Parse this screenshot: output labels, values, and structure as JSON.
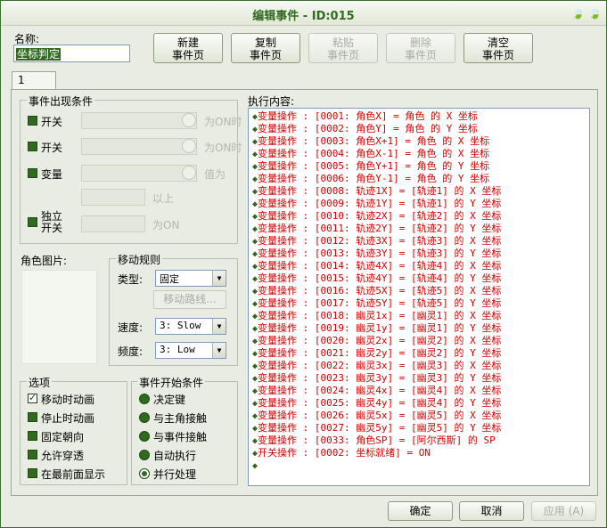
{
  "window": {
    "title": "编辑事件 - ID:015"
  },
  "name": {
    "label": "名称:",
    "value": "坐标判定"
  },
  "toolbar": {
    "new_page": [
      "新建",
      "事件页"
    ],
    "copy_page": [
      "复制",
      "事件页"
    ],
    "paste_page": [
      "粘贴",
      "事件页"
    ],
    "delete_page": [
      "删除",
      "事件页"
    ],
    "clear_page": [
      "清空",
      "事件页"
    ]
  },
  "tabs": [
    "1"
  ],
  "conditions": {
    "title": "事件出现条件",
    "switch1": {
      "label": "开关",
      "suffix": "为ON时"
    },
    "switch2": {
      "label": "开关",
      "suffix": "为ON时"
    },
    "variable": {
      "label": "变量",
      "suffix": "值为",
      "above": "以上"
    },
    "self_switch": {
      "label1": "独立",
      "label2": "开关",
      "suffix": "为ON"
    }
  },
  "graphic": {
    "label": "角色图片:"
  },
  "movement": {
    "title": "移动规则",
    "type_label": "类型:",
    "type_value": "固定",
    "route_button": "移动路线...",
    "speed_label": "速度:",
    "speed_value": "3: Slow",
    "freq_label": "频度:",
    "freq_value": "3: Low"
  },
  "options": {
    "title": "选项",
    "items": [
      "移动时动画",
      "停止时动画",
      "固定朝向",
      "允许穿透",
      "在最前面显示"
    ],
    "checked": [
      true,
      false,
      false,
      false,
      false
    ]
  },
  "trigger": {
    "title": "事件开始条件",
    "items": [
      "决定键",
      "与主角接触",
      "与事件接触",
      "自动执行",
      "并行处理"
    ],
    "selected": 4
  },
  "exec": {
    "label": "执行内容:",
    "lines": [
      "变量操作 : [0001: 角色X] = 角色 的 X 坐标",
      "变量操作 : [0002: 角色Y] = 角色 的 Y 坐标",
      "变量操作 : [0003: 角色X+1] = 角色 的 X 坐标",
      "变量操作 : [0004: 角色X-1] = 角色 的 X 坐标",
      "变量操作 : [0005: 角色Y+1] = 角色 的 Y 坐标",
      "变量操作 : [0006: 角色Y-1] = 角色 的 Y 坐标",
      "变量操作 : [0008: 轨迹1X] = [轨迹1] 的 X 坐标",
      "变量操作 : [0009: 轨迹1Y] = [轨迹1] 的 Y 坐标",
      "变量操作 : [0010: 轨迹2X] = [轨迹2] 的 X 坐标",
      "变量操作 : [0011: 轨迹2Y] = [轨迹2] 的 Y 坐标",
      "变量操作 : [0012: 轨迹3X] = [轨迹3] 的 X 坐标",
      "变量操作 : [0013: 轨迹3Y] = [轨迹3] 的 Y 坐标",
      "变量操作 : [0014: 轨迹4X] = [轨迹4] 的 X 坐标",
      "变量操作 : [0015: 轨迹4Y] = [轨迹4] 的 Y 坐标",
      "变量操作 : [0016: 轨迹5X] = [轨迹5] 的 X 坐标",
      "变量操作 : [0017: 轨迹5Y] = [轨迹5] 的 Y 坐标",
      "变量操作 : [0018: 幽灵1x] = [幽灵1] 的 X 坐标",
      "变量操作 : [0019: 幽灵1y] = [幽灵1] 的 Y 坐标",
      "变量操作 : [0020: 幽灵2x] = [幽灵2] 的 X 坐标",
      "变量操作 : [0021: 幽灵2y] = [幽灵2] 的 Y 坐标",
      "变量操作 : [0022: 幽灵3x] = [幽灵3] 的 X 坐标",
      "变量操作 : [0023: 幽灵3y] = [幽灵3] 的 Y 坐标",
      "变量操作 : [0024: 幽灵4x] = [幽灵4] 的 X 坐标",
      "变量操作 : [0025: 幽灵4y] = [幽灵4] 的 Y 坐标",
      "变量操作 : [0026: 幽灵5x] = [幽灵5] 的 X 坐标",
      "变量操作 : [0027: 幽灵5y] = [幽灵5] 的 Y 坐标",
      "变量操作 : [0033: 角色SP] = [阿尔西斯] 的 SP",
      "开关操作 : [0002: 坐标就绪] = ON",
      ""
    ]
  },
  "buttons": {
    "ok": "确定",
    "cancel": "取消",
    "apply": "应用 (A)"
  },
  "colors": {
    "accent": "#2f6a1f",
    "command_text": "#d00000"
  },
  "icons": {
    "minimize": "leaf-icon",
    "close": "leaf-icon"
  }
}
